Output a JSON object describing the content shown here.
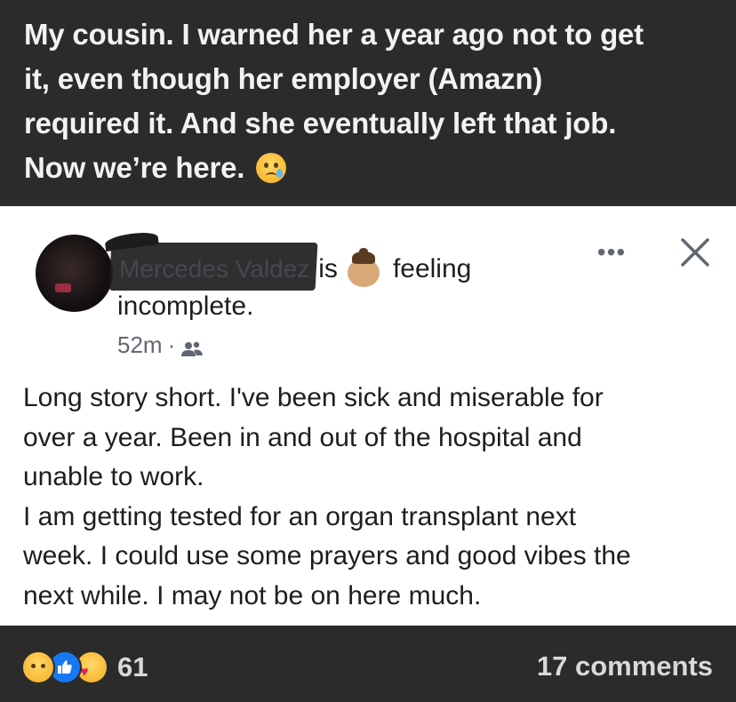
{
  "caption": {
    "lines": [
      "My cousin. I warned her a year ago not to get",
      "it, even though her employer (Amazn)",
      "required it. And she eventually left that job.",
      "Now we’re here."
    ],
    "emoji": "crying-face"
  },
  "post": {
    "author_name": "Mercedes Valdez",
    "is_text": "is",
    "feeling_text": "feeling",
    "feeling_value": "incomplete.",
    "feeling_emoji": "person-face-icon",
    "timestamp": "52m",
    "meta_separator": "·",
    "audience_icon": "friends-icon",
    "more_label": "•••",
    "close_label": "✕",
    "body_lines": [
      "Long story short. I've been sick and miserable for",
      "over a year. Been in and out of the hospital and",
      "unable to work.",
      "I am getting tested  for an organ transplant next",
      "week. I could use some prayers and good vibes the",
      "next while. I may not be on here much."
    ]
  },
  "footer": {
    "reactions": [
      "sad",
      "like",
      "care"
    ],
    "reaction_count": "61",
    "comments_label": "17 comments"
  },
  "colors": {
    "background_dark": "#2b2b2b",
    "card": "#ffffff",
    "text_primary": "#1c1e21",
    "text_secondary": "#606770",
    "like_blue": "#1877f2"
  }
}
